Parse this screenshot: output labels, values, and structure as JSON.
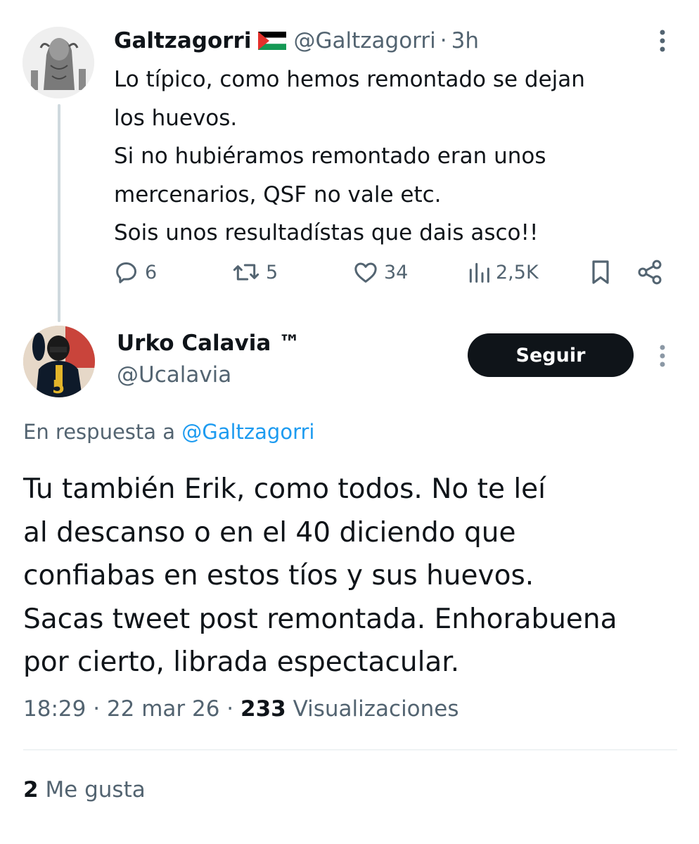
{
  "parent_tweet": {
    "author_name": "Galtzagorri",
    "flag_icon": "palestine-flag",
    "handle": "@Galtzagorri",
    "separator": "·",
    "time": "3h",
    "text_lines": [
      "Lo típico, como hemos remontado se dejan",
      "los huevos.",
      "Si no hubiéramos remontado eran unos",
      "mercenarios, QSF no vale etc.",
      "Sois unos resultadístas que dais asco!!"
    ],
    "actions": {
      "replies": "6",
      "retweets": "5",
      "likes": "34",
      "views": "2,5K"
    }
  },
  "reply_tweet": {
    "author_name": "Urko Calavia ™",
    "handle": "@Ucalavia",
    "follow_label": "Seguir",
    "reply_prefix": "En respuesta a",
    "reply_to_handle": "@Galtzagorri",
    "text_lines": [
      "Tu también Erik, como todos. No te leí",
      "al descanso o en el 40 diciendo que",
      "confiabas en estos tíos y sus huevos.",
      "Sacas tweet post remontada. Enhorabuena",
      "por cierto, librada espectacular."
    ],
    "timestamp": "18:29 · 22 mar 26 ·",
    "views_count": "233",
    "views_label": "Visualizaciones",
    "likes_count": "2",
    "likes_label": "Me gusta"
  },
  "colors": {
    "text": "#0f1419",
    "secondary": "#536471",
    "link": "#1d9bf0",
    "button_bg": "#0f1419"
  }
}
